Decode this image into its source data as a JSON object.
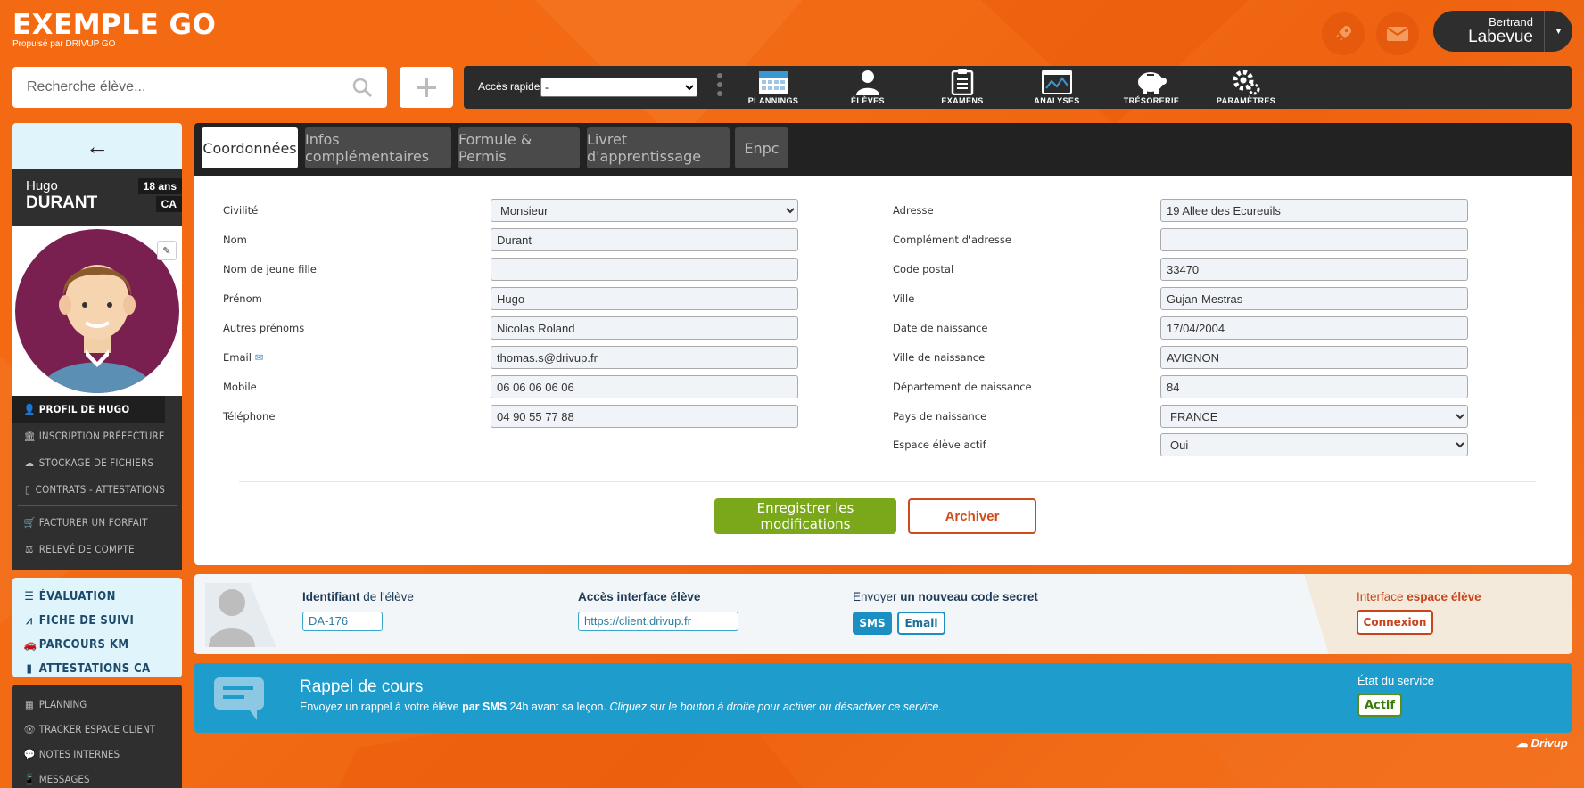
{
  "app": {
    "brand": "EXEMPLE GO",
    "tagline": "Propulsé par DRIVUP GO"
  },
  "user": {
    "first_name": "Bertrand",
    "last_name": "Labevue"
  },
  "search": {
    "placeholder": "Recherche élève..."
  },
  "toolbar": {
    "quick_access_label": "Accès rapides",
    "quick_access_value": "-",
    "nav": [
      {
        "label": "PLANNINGS",
        "icon": "calendar-icon"
      },
      {
        "label": "ÉLÈVES",
        "icon": "student-icon"
      },
      {
        "label": "EXAMENS",
        "icon": "clipboard-icon"
      },
      {
        "label": "ANALYSES",
        "icon": "chart-icon"
      },
      {
        "label": "TRÉSORERIE",
        "icon": "piggy-bank-icon"
      },
      {
        "label": "PARAMÈTRES",
        "icon": "gears-icon"
      }
    ]
  },
  "student": {
    "first_name": "Hugo",
    "last_name": "DURANT",
    "age": "18 ans",
    "category": "CA"
  },
  "sidebar": {
    "menu": [
      {
        "label": "PROFIL DE HUGO",
        "icon": "user-icon"
      },
      {
        "label": "INSCRIPTION PRÉFECTURE",
        "icon": "bank-icon"
      },
      {
        "label": "STOCKAGE DE FICHIERS",
        "icon": "cloud-icon"
      },
      {
        "label": "CONTRATS - ATTESTATIONS",
        "icon": "file-icon"
      },
      {
        "label": "FACTURER UN FORFAIT",
        "icon": "cart-icon"
      },
      {
        "label": "RELEVÉ DE COMPTE",
        "icon": "scale-icon"
      }
    ],
    "blue": [
      {
        "label": "ÉVALUATION",
        "icon": "list-icon"
      },
      {
        "label": "FICHE DE SUIVI",
        "icon": "road-icon"
      },
      {
        "label": "PARCOURS KM",
        "icon": "car-icon"
      },
      {
        "label": "ATTESTATIONS CA",
        "icon": "file-icon"
      }
    ],
    "bottom": [
      {
        "label": "PLANNING",
        "icon": "calendar-icon"
      },
      {
        "label": "TRACKER ESPACE CLIENT",
        "icon": "eye-icon"
      },
      {
        "label": "NOTES INTERNES",
        "icon": "comment-icon"
      },
      {
        "label": "MESSAGES",
        "icon": "mobile-icon"
      }
    ]
  },
  "tabs": [
    "Coordonnées",
    "Infos complémentaires",
    "Formule & Permis",
    "Livret d'apprentissage",
    "Enpc"
  ],
  "form_left": [
    {
      "label": "Civilité",
      "value": "Monsieur",
      "type": "select"
    },
    {
      "label": "Nom",
      "value": "Durant",
      "type": "input"
    },
    {
      "label": "Nom de jeune fille",
      "value": "",
      "type": "input"
    },
    {
      "label": "Prénom",
      "value": "Hugo",
      "type": "input"
    },
    {
      "label": "Autres prénoms",
      "value": "Nicolas Roland",
      "type": "input"
    },
    {
      "label": "Email",
      "value": "thomas.s@drivup.fr",
      "type": "input"
    },
    {
      "label": "Mobile",
      "value": "06 06 06 06 06",
      "type": "input"
    },
    {
      "label": "Téléphone",
      "value": "04 90 55 77 88",
      "type": "input"
    }
  ],
  "form_right": [
    {
      "label": "Adresse",
      "value": "19 Allee des Ecureuils",
      "type": "input"
    },
    {
      "label": "Complément d'adresse",
      "value": "",
      "type": "input"
    },
    {
      "label": "Code postal",
      "value": "33470",
      "type": "input"
    },
    {
      "label": "Ville",
      "value": "Gujan-Mestras",
      "type": "input"
    },
    {
      "label": "Date de naissance",
      "value": "17/04/2004",
      "type": "input"
    },
    {
      "label": "Ville de naissance",
      "value": "AVIGNON",
      "type": "input"
    },
    {
      "label": "Département de naissance",
      "value": "84",
      "type": "input"
    },
    {
      "label": "Pays de naissance",
      "value": "FRANCE",
      "type": "select"
    },
    {
      "label": "Espace élève actif",
      "value": "Oui",
      "type": "select"
    }
  ],
  "actions": {
    "save": "Enregistrer les modifications",
    "archive": "Archiver"
  },
  "info": {
    "id_bold": "Identifiant",
    "id_rest": " de l'élève",
    "id_value": "DA-176",
    "access_label": "Accès interface élève",
    "access_value": "https://client.drivup.fr",
    "code_pre": "Envoyer ",
    "code_bold": "un nouveau code secret",
    "sms": "SMS",
    "email": "Email",
    "iface_pre": "Interface ",
    "iface_bold": "espace élève",
    "connexion": "Connexion"
  },
  "reminder": {
    "title": "Rappel de cours",
    "desc_1": "Envoyez un rappel à votre élève ",
    "desc_bold": "par SMS",
    "desc_2": " 24h avant sa leçon. ",
    "desc_italic": "Cliquez sur le bouton à droite pour activer ou désactiver ce service.",
    "status_label": "État du service",
    "status_value": "Actif"
  },
  "footer": {
    "logo": "Drivup"
  }
}
